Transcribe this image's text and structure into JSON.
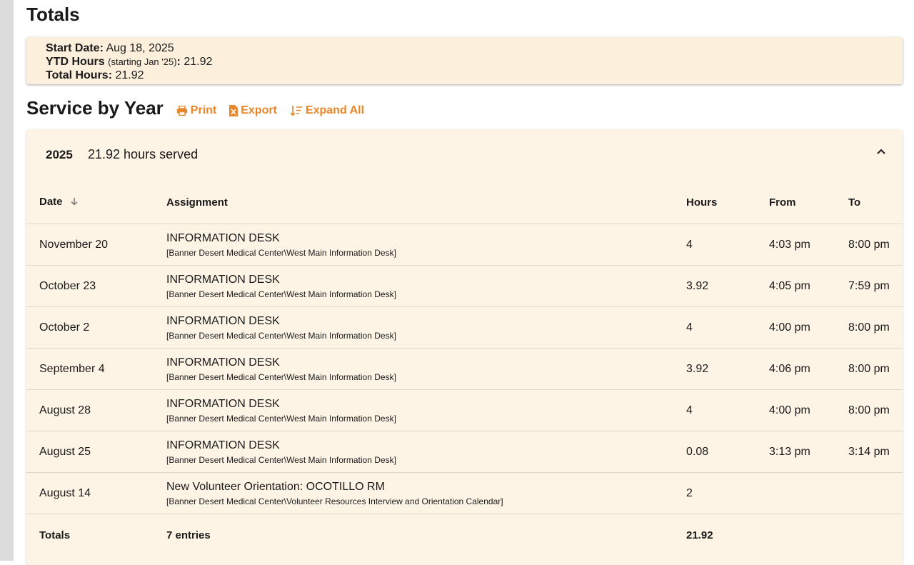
{
  "totals": {
    "title": "Totals",
    "start_date_label": "Start Date:",
    "start_date_value": "Aug 18, 2025",
    "ytd_label": "YTD Hours",
    "ytd_note": "(starting Jan '25)",
    "ytd_colon": ":",
    "ytd_value": "21.92",
    "total_label": "Total Hours:",
    "total_value": "21.92"
  },
  "service": {
    "title": "Service by Year",
    "print_label": "Print",
    "export_label": "Export",
    "expand_label": "Expand All",
    "accent_color": "#e8862a"
  },
  "year": {
    "year": "2025",
    "hours_text": "21.92 hours served"
  },
  "table": {
    "headers": {
      "date": "Date",
      "assignment": "Assignment",
      "hours": "Hours",
      "from": "From",
      "to": "To"
    },
    "rows": [
      {
        "date": "November 20",
        "title": "INFORMATION DESK",
        "location": "[Banner Desert Medical Center\\West Main Information Desk]",
        "hours": "4",
        "from": "4:03 pm",
        "to": "8:00 pm"
      },
      {
        "date": "October 23",
        "title": "INFORMATION DESK",
        "location": "[Banner Desert Medical Center\\West Main Information Desk]",
        "hours": "3.92",
        "from": "4:05 pm",
        "to": "7:59 pm"
      },
      {
        "date": "October 2",
        "title": "INFORMATION DESK",
        "location": "[Banner Desert Medical Center\\West Main Information Desk]",
        "hours": "4",
        "from": "4:00 pm",
        "to": "8:00 pm"
      },
      {
        "date": "September 4",
        "title": "INFORMATION DESK",
        "location": "[Banner Desert Medical Center\\West Main Information Desk]",
        "hours": "3.92",
        "from": "4:06 pm",
        "to": "8:00 pm"
      },
      {
        "date": "August 28",
        "title": "INFORMATION DESK",
        "location": "[Banner Desert Medical Center\\West Main Information Desk]",
        "hours": "4",
        "from": "4:00 pm",
        "to": "8:00 pm"
      },
      {
        "date": "August 25",
        "title": "INFORMATION DESK",
        "location": "[Banner Desert Medical Center\\West Main Information Desk]",
        "hours": "0.08",
        "from": "3:13 pm",
        "to": "3:14 pm"
      },
      {
        "date": "August 14",
        "title": "New Volunteer Orientation: OCOTILLO RM",
        "location": "[Banner Desert Medical Center\\Volunteer Resources Interview and Orientation Calendar]",
        "hours": "2",
        "from": "",
        "to": ""
      }
    ],
    "footer": {
      "label": "Totals",
      "entries": "7 entries",
      "hours": "21.92"
    }
  }
}
